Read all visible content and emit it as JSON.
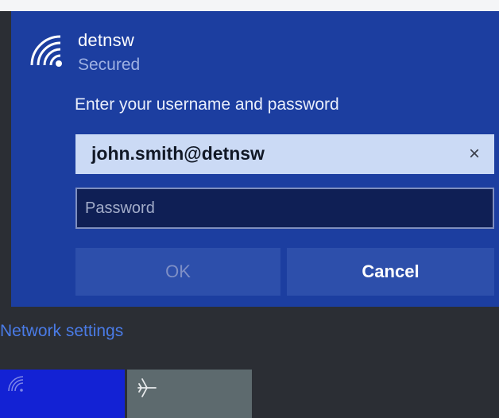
{
  "network": {
    "ssid": "detnsw",
    "security": "Secured",
    "prompt": "Enter your username and password"
  },
  "username_field": {
    "value": "john.smith@detnsw",
    "clear_glyph": "×"
  },
  "password_field": {
    "placeholder": "Password"
  },
  "buttons": {
    "ok": "OK",
    "cancel": "Cancel"
  },
  "network_settings_label": "Network settings",
  "quick_actions": [
    {
      "icon": "wifi-icon",
      "active": true
    },
    {
      "icon": "airplane-icon",
      "active": false
    }
  ],
  "colors": {
    "flyout_bg": "#1c3ea0",
    "field_bg": "#cbdaf5",
    "button_bg": "#2d4fab",
    "link": "#4a7be6",
    "wifi_tile": "#1322d4"
  }
}
